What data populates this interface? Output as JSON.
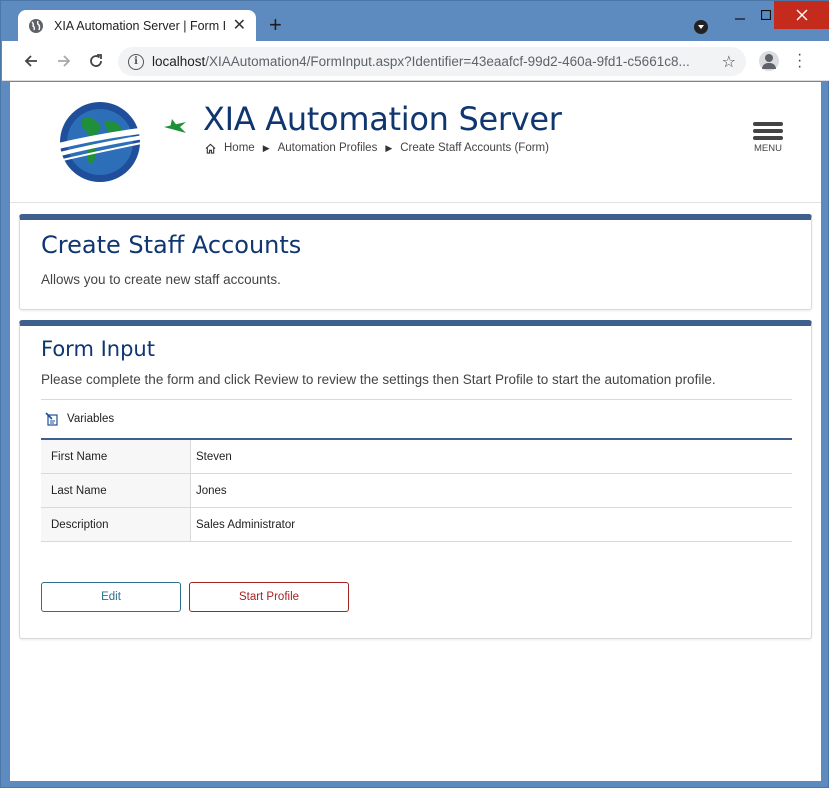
{
  "browser": {
    "tab_title": "XIA Automation Server | Form Input",
    "url_host": "localhost",
    "url_path": "/XIAAutomation4/FormInput.aspx?Identifier=43eaafcf-99d2-460a-9fd1-c5661c8...",
    "new_tab_label": "+",
    "tab_close_label": "✕"
  },
  "header": {
    "site_title": "XIA Automation Server",
    "breadcrumb": [
      "Home",
      "Automation Profiles",
      "Create Staff Accounts (Form)"
    ],
    "menu_label": "MENU"
  },
  "profile_card": {
    "title": "Create Staff Accounts",
    "description": "Allows you to create new staff accounts."
  },
  "form_card": {
    "title": "Form Input",
    "description": "Please complete the form and click Review to review the settings then Start Profile to start the automation profile.",
    "variables_label": "Variables",
    "rows": [
      {
        "label": "First Name",
        "value": "Steven"
      },
      {
        "label": "Last Name",
        "value": "Jones"
      },
      {
        "label": "Description",
        "value": "Sales Administrator"
      }
    ],
    "edit_label": "Edit",
    "start_label": "Start Profile"
  },
  "colors": {
    "brand_blue": "#0f3670",
    "card_accent": "#3f5f8c",
    "edit_border": "#2c6f8e",
    "start_border": "#a32424",
    "window_frame": "#5d8bbf"
  }
}
